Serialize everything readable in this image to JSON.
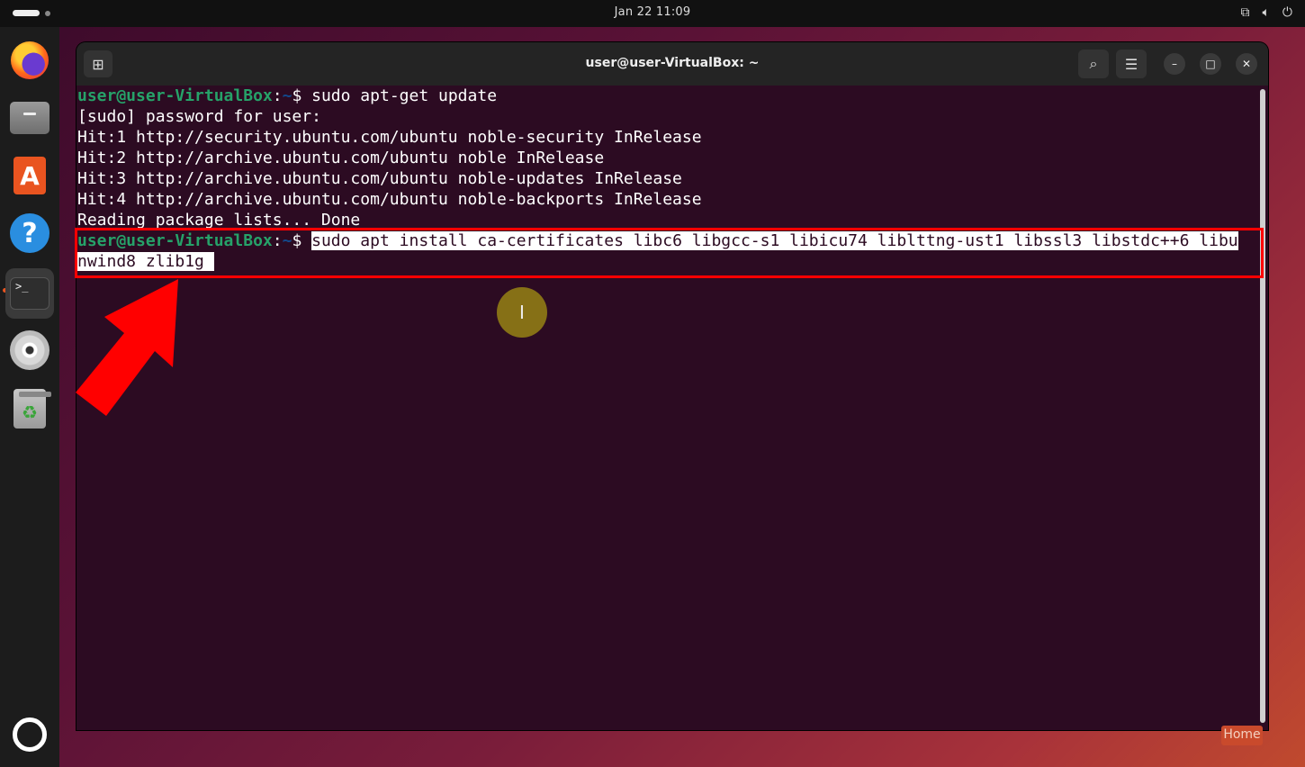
{
  "topbar": {
    "clock": "Jan 22  11:09",
    "tray_icons": [
      "network-icon",
      "volume-icon",
      "power-icon"
    ]
  },
  "dock": {
    "items": [
      {
        "name": "firefox",
        "icon": "firefox-icon"
      },
      {
        "name": "files",
        "icon": "files-icon"
      },
      {
        "name": "app-center",
        "icon": "store-icon"
      },
      {
        "name": "help",
        "icon": "help-icon"
      },
      {
        "name": "terminal",
        "icon": "terminal-icon",
        "active": true
      },
      {
        "name": "disc",
        "icon": "disc-icon"
      },
      {
        "name": "trash",
        "icon": "trash-icon"
      },
      {
        "name": "show-apps",
        "icon": "ubuntu-icon"
      }
    ]
  },
  "window": {
    "title": "user@user-VirtualBox: ~"
  },
  "terminal": {
    "prompt_user": "user@user-VirtualBox",
    "prompt_colon": ":",
    "prompt_path": "~",
    "prompt_symbol": "$ ",
    "cmd1": "sudo apt-get update",
    "out1": "[sudo] password for user:",
    "out2": "Hit:1 http://security.ubuntu.com/ubuntu noble-security InRelease",
    "out3": "Hit:2 http://archive.ubuntu.com/ubuntu noble InRelease",
    "out4": "Hit:3 http://archive.ubuntu.com/ubuntu noble-updates InRelease",
    "out5": "Hit:4 http://archive.ubuntu.com/ubuntu noble-backports InRelease",
    "out6": "Reading package lists... Done",
    "cmd2_line1": "sudo apt install ca-certificates libc6 libgcc-s1 libicu74 liblttng-ust1 libssl3 libstdc++6 libu",
    "cmd2_line2": "nwind8 zlib1g "
  },
  "desktop": {
    "home_label": "Home"
  },
  "colors": {
    "prompt_user": "#26a269",
    "prompt_path": "#12488b",
    "terminal_bg": "#2c0b22",
    "highlight": "#ff0000"
  }
}
